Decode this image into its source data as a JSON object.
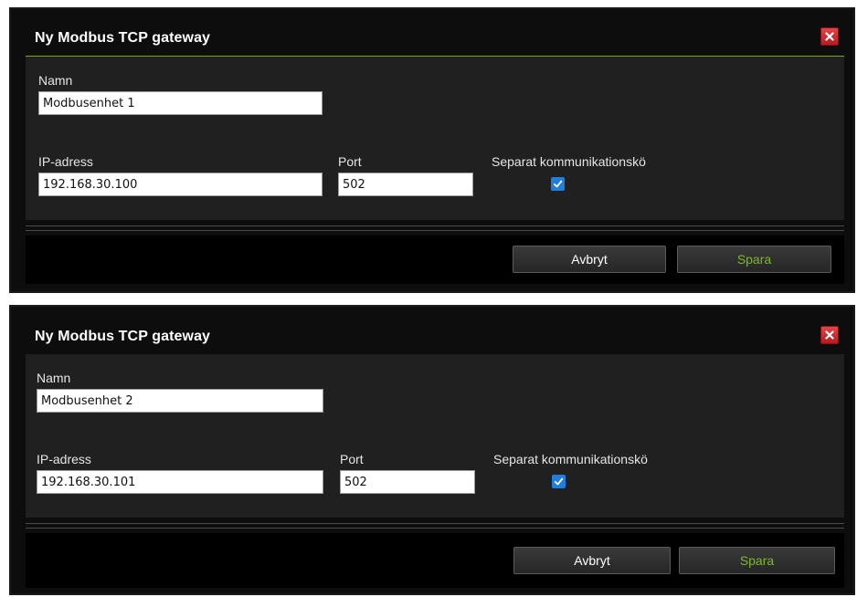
{
  "dialogs": [
    {
      "title": "Ny Modbus TCP gateway",
      "close_label": "×",
      "name_label": "Namn",
      "name_value": "Modbusenhet 1",
      "ip_label": "IP-adress",
      "ip_value": "192.168.30.100",
      "port_label": "Port",
      "port_value": "502",
      "queue_label": "Separat kommunikationskö",
      "queue_checked": true,
      "cancel_label": "Avbryt",
      "save_label": "Spara"
    },
    {
      "title": "Ny Modbus TCP gateway",
      "close_label": "×",
      "name_label": "Namn",
      "name_value": "Modbusenhet 2",
      "ip_label": "IP-adress",
      "ip_value": "192.168.30.101",
      "port_label": "Port",
      "port_value": "502",
      "queue_label": "Separat kommunikationskö",
      "queue_checked": true,
      "cancel_label": "Avbryt",
      "save_label": "Spara"
    }
  ],
  "colors": {
    "accent_green": "#7db82a",
    "title_rule": "#7aa61e",
    "close_red": "#c8262b",
    "checkbox_blue": "#1f7fdc",
    "dialog_bg": "#202020",
    "footer_bg": "#000000"
  },
  "icons": {
    "close": "close-icon",
    "check": "checkmark-icon"
  }
}
